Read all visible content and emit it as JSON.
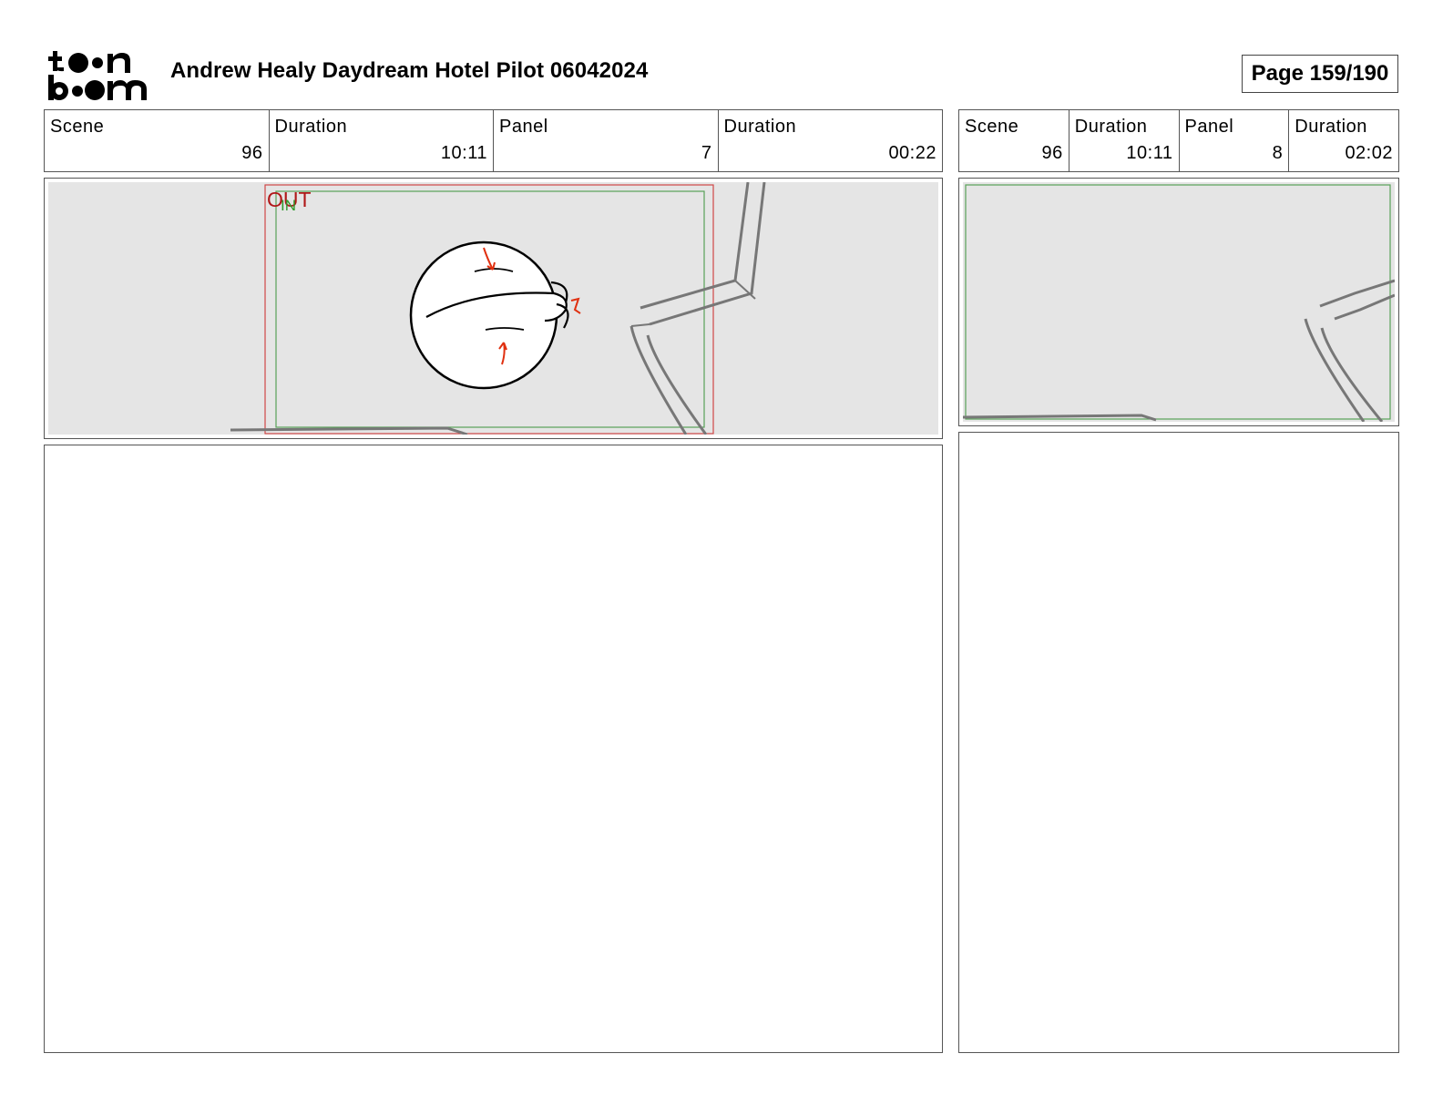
{
  "header": {
    "logo_text": "toon boom",
    "title": "Andrew Healy Daydream Hotel Pilot 06042024",
    "page": "Page 159/190"
  },
  "panels": [
    {
      "scene_label": "Scene",
      "scene_value": "96",
      "scene_duration_label": "Duration",
      "scene_duration_value": "10:11",
      "panel_label": "Panel",
      "panel_value": "7",
      "panel_duration_label": "Duration",
      "panel_duration_value": "00:22",
      "frame_labels": {
        "out": "OUT",
        "in": "IN"
      }
    },
    {
      "scene_label": "Scene",
      "scene_value": "96",
      "scene_duration_label": "Duration",
      "scene_duration_value": "10:11",
      "panel_label": "Panel",
      "panel_value": "8",
      "panel_duration_label": "Duration",
      "panel_duration_value": "02:02"
    }
  ],
  "colors": {
    "safe_frame_green": "#58a058",
    "camera_frame_red": "#d04848",
    "annotation_red": "#e03010",
    "art_background": "#e5e5e5"
  }
}
